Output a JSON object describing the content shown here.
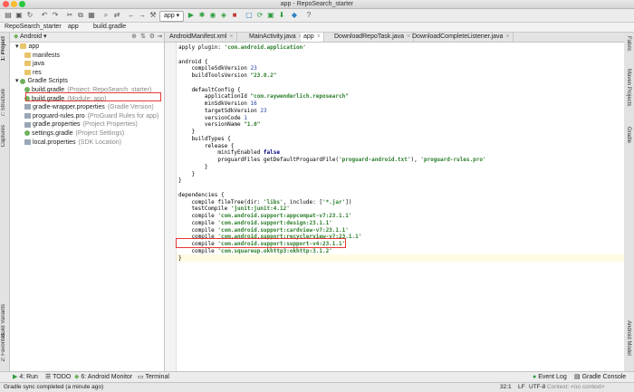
{
  "window": {
    "title": "app - RepoSearch_starter"
  },
  "toolbar": {
    "run_config": "app"
  },
  "navbar": {
    "crumbs": [
      "RepoSearch_starter",
      "app",
      "build.gradle"
    ]
  },
  "left_tabs": [
    "1: Project",
    "7: Structure",
    "Captures",
    "Build Variants",
    "2: Favorites"
  ],
  "right_tabs": [
    "Fabric",
    "Maven Projects",
    "Gradle",
    "Android Model"
  ],
  "project": {
    "view": "Android",
    "tree": [
      {
        "label": "app",
        "level": 0,
        "icon": "folder"
      },
      {
        "label": "manifests",
        "level": 1,
        "icon": "folder"
      },
      {
        "label": "java",
        "level": 1,
        "icon": "folder"
      },
      {
        "label": "res",
        "level": 1,
        "icon": "folder"
      },
      {
        "label": "Gradle Scripts",
        "level": 0,
        "icon": "gradle"
      },
      {
        "label": "build.gradle",
        "hint": "(Project: RepoSearch_starter)",
        "level": 1,
        "icon": "gradle"
      },
      {
        "label": "build.gradle",
        "hint": "(Module: app)",
        "level": 1,
        "icon": "gradle"
      },
      {
        "label": "gradle-wrapper.properties",
        "hint": "(Gradle Version)",
        "level": 1,
        "icon": "props"
      },
      {
        "label": "proguard-rules.pro",
        "hint": "(ProGuard Rules for app)",
        "level": 1,
        "icon": "props"
      },
      {
        "label": "gradle.properties",
        "hint": "(Project Properties)",
        "level": 1,
        "icon": "props"
      },
      {
        "label": "settings.gradle",
        "hint": "(Project Settings)",
        "level": 1,
        "icon": "gradle"
      },
      {
        "label": "local.properties",
        "hint": "(SDK Location)",
        "level": 1,
        "icon": "props"
      }
    ]
  },
  "editor_tabs": [
    {
      "label": "AndroidManifest.xml",
      "active": false
    },
    {
      "label": "MainActivity.java",
      "active": false
    },
    {
      "label": "app",
      "active": true
    },
    {
      "label": "DownloadRepoTask.java",
      "active": false
    },
    {
      "label": "DownloadCompleteListener.java",
      "active": false
    }
  ],
  "code": [
    "apply plugin: 'com.android.application'",
    "",
    "android {",
    "    compileSdkVersion 23",
    "    buildToolsVersion \"23.0.2\"",
    "",
    "    defaultConfig {",
    "        applicationId \"com.raywenderlich.reposearch\"",
    "        minSdkVersion 16",
    "        targetSdkVersion 23",
    "        versionCode 1",
    "        versionName \"1.0\"",
    "    }",
    "    buildTypes {",
    "        release {",
    "            minifyEnabled false",
    "            proguardFiles getDefaultProguardFile('proguard-android.txt'), 'proguard-rules.pro'",
    "        }",
    "    }",
    "}",
    "",
    "dependencies {",
    "    compile fileTree(dir: 'libs', include: ['*.jar'])",
    "    testCompile 'junit:junit:4.12'",
    "    compile 'com.android.support:appcompat-v7:23.1.1'",
    "    compile 'com.android.support:design:23.1.1'",
    "    compile 'com.android.support:cardview-v7:23.1.1'",
    "    compile 'com.android.support:recyclerview-v7:23.1.1'",
    "    compile 'com.android.support:support-v4:23.1.1'",
    "    compile 'com.squareup.okhttp3:okhttp:3.1.2'",
    "}"
  ],
  "bottom_tools": [
    "4: Run",
    "TODO",
    "6: Android Monitor",
    "Terminal"
  ],
  "bottom_right": [
    "Event Log",
    "Gradle Console"
  ],
  "status": {
    "message": "Gradle sync completed (a minute ago)",
    "position": "32:1",
    "line_sep": "LF",
    "encoding": "UTF-8",
    "context": "Context: <no context>"
  }
}
